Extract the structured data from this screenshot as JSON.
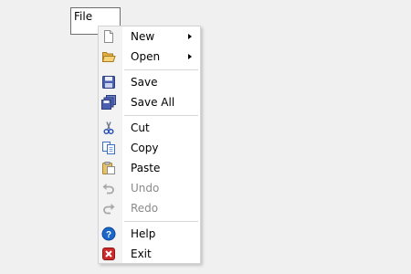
{
  "menubar": {
    "file_label": "File"
  },
  "context_menu": {
    "items": [
      {
        "label": "New",
        "icon": "new-document-icon",
        "submenu": true,
        "enabled": true
      },
      {
        "label": "Open",
        "icon": "open-folder-icon",
        "submenu": true,
        "enabled": true
      },
      {
        "label": "Save",
        "icon": "save-icon",
        "submenu": false,
        "enabled": true
      },
      {
        "label": "Save All",
        "icon": "save-all-icon",
        "submenu": false,
        "enabled": true
      },
      {
        "label": "Cut",
        "icon": "cut-icon",
        "submenu": false,
        "enabled": true
      },
      {
        "label": "Copy",
        "icon": "copy-icon",
        "submenu": false,
        "enabled": true
      },
      {
        "label": "Paste",
        "icon": "paste-icon",
        "submenu": false,
        "enabled": true
      },
      {
        "label": "Undo",
        "icon": "undo-icon",
        "submenu": false,
        "enabled": false
      },
      {
        "label": "Redo",
        "icon": "redo-icon",
        "submenu": false,
        "enabled": false
      },
      {
        "label": "Help",
        "icon": "help-icon",
        "submenu": false,
        "enabled": true
      },
      {
        "label": "Exit",
        "icon": "exit-icon",
        "submenu": false,
        "enabled": true
      }
    ]
  },
  "colors": {
    "background": "#f0f0f0",
    "menu_background": "#ffffff",
    "gutter": "#f3f3f3",
    "disabled_text": "#8a8a8a",
    "help_icon": "#1a66c9",
    "exit_icon": "#cc2a2a"
  }
}
